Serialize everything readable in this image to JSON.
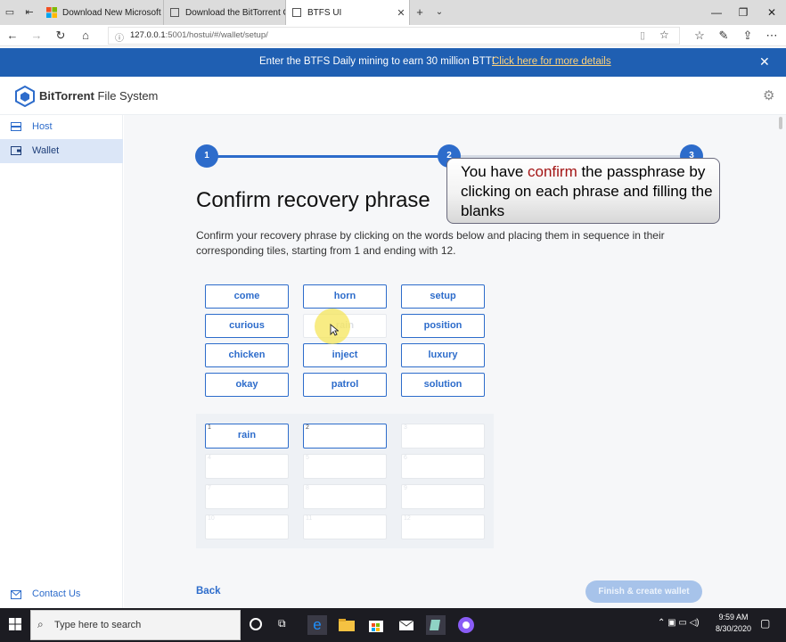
{
  "browser": {
    "tabs": [
      {
        "title": "Download New Microsoft Ec",
        "active": false
      },
      {
        "title": "Download the BitTorrent Cla",
        "active": false
      },
      {
        "title": "BTFS UI",
        "active": true
      }
    ],
    "url_host": "127.0.0.1",
    "url_path": ":5001/hostui/#/wallet/setup/"
  },
  "banner": {
    "text": "Enter the BTFS Daily mining to earn 30 million BTT!",
    "link": "Click here for more details"
  },
  "brand": {
    "bold": "BitTorrent",
    "rest": " File System"
  },
  "sidebar": {
    "items": [
      {
        "label": "Host",
        "active": false,
        "icon": "host-icon"
      },
      {
        "label": "Wallet",
        "active": true,
        "icon": "wallet-icon"
      }
    ],
    "contact": "Contact Us"
  },
  "steps": {
    "labels": [
      "1",
      "2",
      "3"
    ],
    "current": 2
  },
  "page": {
    "title": "Confirm recovery phrase",
    "description": "Confirm your recovery phrase by clicking on the words below and placing them in sequence in their corresponding tiles, starting from 1 and ending with 12."
  },
  "word_grid": [
    {
      "word": "come",
      "used": false
    },
    {
      "word": "horn",
      "used": false
    },
    {
      "word": "setup",
      "used": false
    },
    {
      "word": "curious",
      "used": false
    },
    {
      "word": "rain",
      "used": true
    },
    {
      "word": "position",
      "used": false
    },
    {
      "word": "chicken",
      "used": false
    },
    {
      "word": "inject",
      "used": false
    },
    {
      "word": "luxury",
      "used": false
    },
    {
      "word": "okay",
      "used": false
    },
    {
      "word": "patrol",
      "used": false
    },
    {
      "word": "solution",
      "used": false
    }
  ],
  "slots": [
    {
      "num": "1",
      "value": "rain"
    },
    {
      "num": "2",
      "value": ""
    },
    {
      "num": "3",
      "value": ""
    },
    {
      "num": "4",
      "value": ""
    },
    {
      "num": "5",
      "value": ""
    },
    {
      "num": "6",
      "value": ""
    },
    {
      "num": "7",
      "value": ""
    },
    {
      "num": "8",
      "value": ""
    },
    {
      "num": "9",
      "value": ""
    },
    {
      "num": "10",
      "value": ""
    },
    {
      "num": "11",
      "value": ""
    },
    {
      "num": "12",
      "value": ""
    }
  ],
  "buttons": {
    "back": "Back",
    "finish": "Finish & create wallet"
  },
  "callout": {
    "prefix": "You have ",
    "highlight": "confirm",
    "suffix": " the passphrase by clicking on each phrase and filling the blanks"
  },
  "taskbar": {
    "search_placeholder": "Type here to search",
    "time": "9:59 AM",
    "date": "8/30/2020"
  },
  "colors": {
    "accent": "#2d6ccb",
    "banner": "#1f5fb2",
    "callout_highlight": "#a31515"
  }
}
